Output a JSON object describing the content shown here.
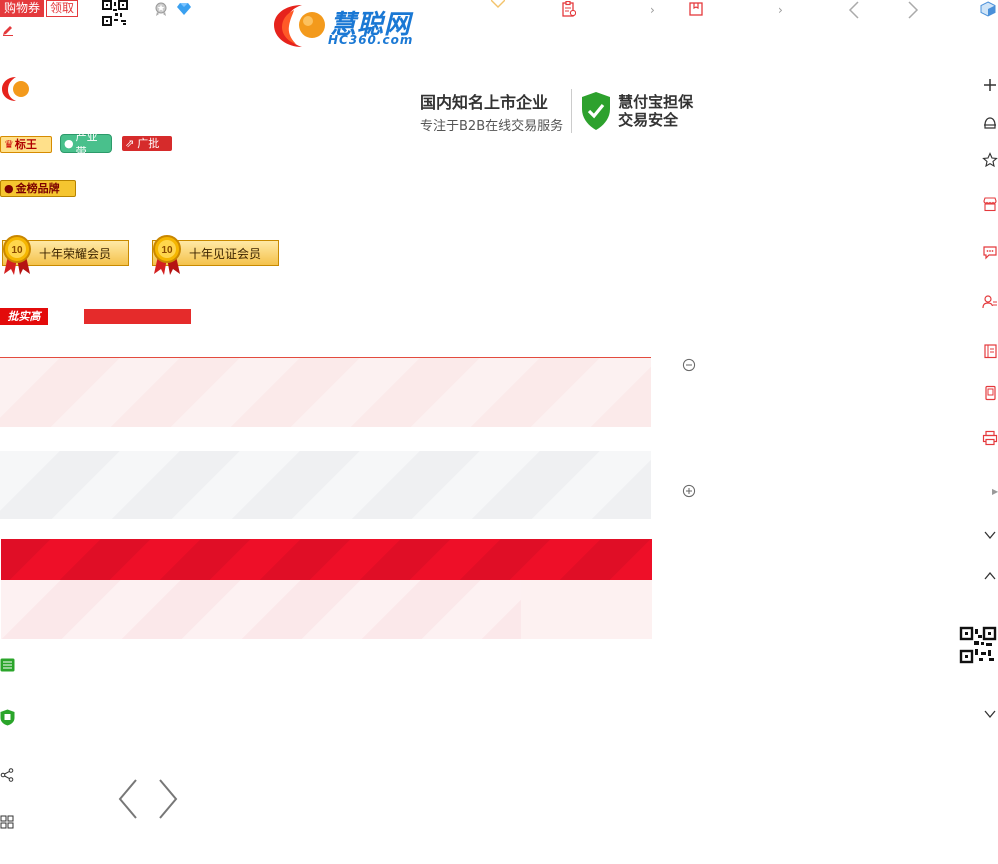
{
  "topbar": {
    "coupon_label": "购物券",
    "coupon_action": "领取",
    "logo_text": "慧聪网",
    "logo_domain": "HC360.com",
    "chevron": "›"
  },
  "promo": {
    "line1": "国内知名上市企业",
    "line2": "专注于B2B在线交易服务",
    "right1": "慧付宝担保",
    "right2": "交易安全"
  },
  "tags": {
    "biaowang": "标王",
    "chandai": "产业带",
    "guangpi": "广批",
    "jinbang": "金榜品牌"
  },
  "awards": {
    "award1": "十年荣耀会员",
    "award2": "十年见证会员",
    "number": "10"
  },
  "badges": {
    "pishi": "批实高"
  },
  "colors": {
    "brand_red": "#e4393c",
    "brand_blue": "#1a78d4",
    "banner_red": "#ee0f28"
  },
  "icons": {
    "sidebar": [
      "plus-icon",
      "helmet-icon",
      "star-icon",
      "store-icon",
      "chat-icon",
      "contact-icon",
      "catalog-icon",
      "phone-icon",
      "printer-icon",
      "chevron-down-icon",
      "chevron-up-icon",
      "qr-code-icon",
      "chevron-down-icon"
    ]
  }
}
